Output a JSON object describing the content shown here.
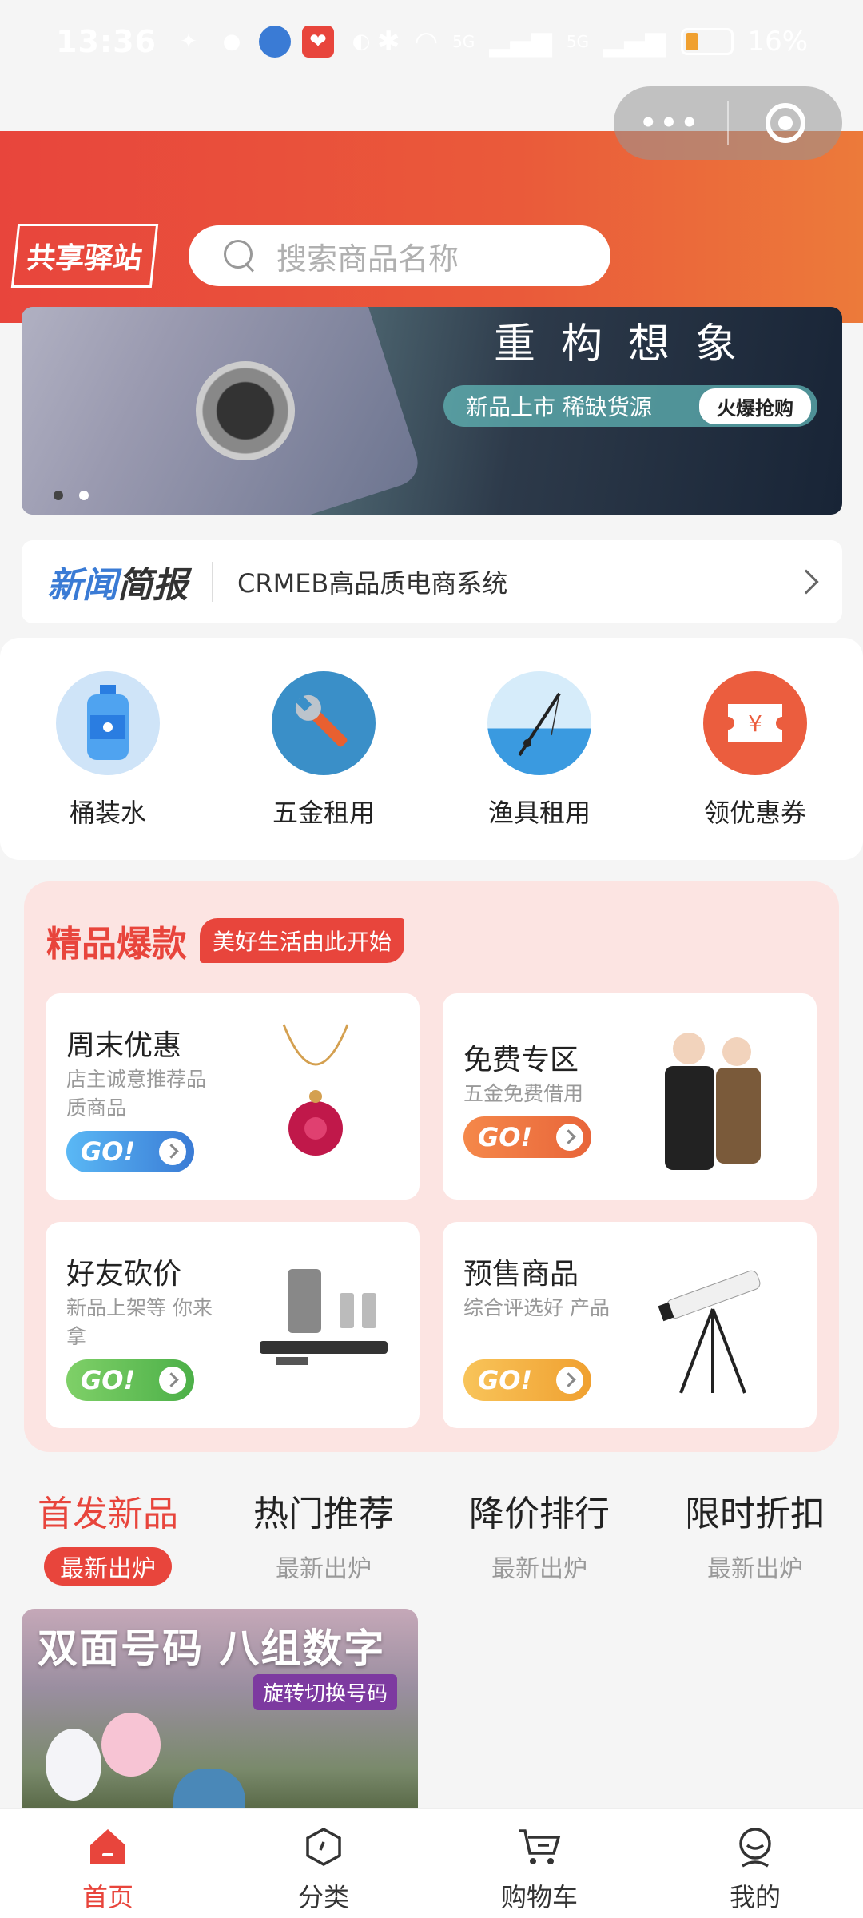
{
  "status_bar": {
    "time": "13:36",
    "battery": "16%",
    "net1": "5G",
    "net2": "5G"
  },
  "capsule": {
    "more": "•••"
  },
  "header": {
    "logo": "共享驿站",
    "search_placeholder": "搜索商品名称"
  },
  "banner": {
    "title": "重构想象",
    "subtitle": "新品上市 稀缺货源",
    "cta": "火爆抢购"
  },
  "news": {
    "brand_blue": "新闻",
    "brand_dark": "简报",
    "text": "CRMEB高品质电商系统"
  },
  "categories": [
    {
      "label": "桶装水"
    },
    {
      "label": "五金租用"
    },
    {
      "label": "渔具租用"
    },
    {
      "label": "领优惠券"
    }
  ],
  "boutique": {
    "title": "精品爆款",
    "tag": "美好生活由此开始",
    "go_label": "GO!",
    "cards": [
      {
        "title": "周末优惠",
        "sub": "店主诚意推荐品质商品"
      },
      {
        "title": "免费专区",
        "sub": "五金免费借用"
      },
      {
        "title": "好友砍价",
        "sub": "新品上架等 你来拿"
      },
      {
        "title": "预售商品",
        "sub": "综合评选好 产品"
      }
    ]
  },
  "tabs": [
    {
      "title": "首发新品",
      "sub": "最新出炉"
    },
    {
      "title": "热门推荐",
      "sub": "最新出炉"
    },
    {
      "title": "降价排行",
      "sub": "最新出炉"
    },
    {
      "title": "限时折扣",
      "sub": "最新出炉"
    }
  ],
  "product": {
    "title": "双面号码  八组数字",
    "badge": "旋转切换号码"
  },
  "tabbar": [
    {
      "label": "首页"
    },
    {
      "label": "分类"
    },
    {
      "label": "购物车"
    },
    {
      "label": "我的"
    }
  ],
  "colors": {
    "primary": "#e8453c",
    "header_end": "#ec7a3a",
    "boutique_bg": "#fce4e2"
  }
}
